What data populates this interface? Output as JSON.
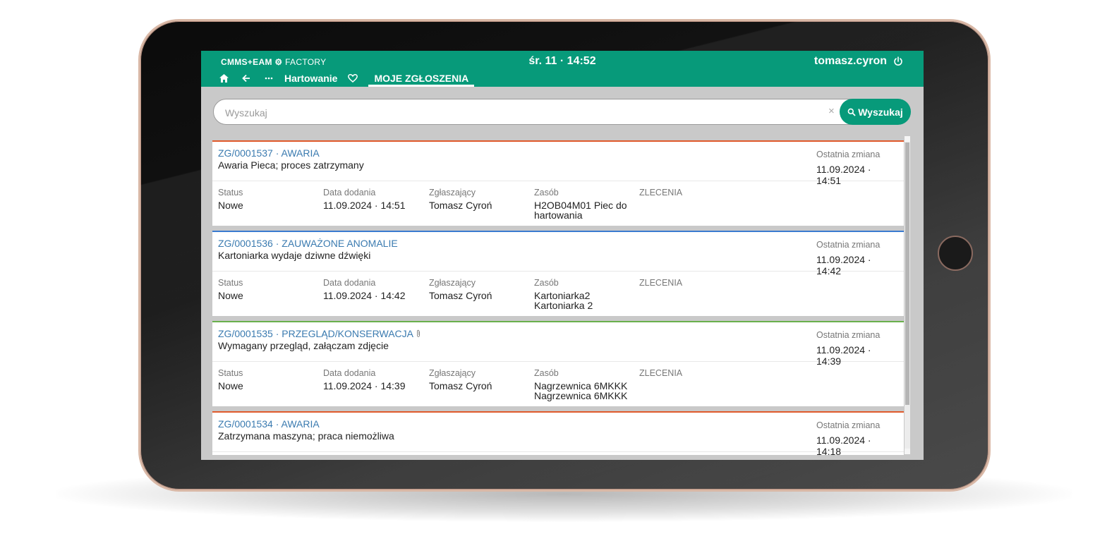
{
  "header": {
    "logo_bold": "CMMS+EAM",
    "logo_light": "FACTORY",
    "clock": "śr. 11 · 14:52",
    "user": "tomasz.cyron"
  },
  "nav": {
    "breadcrumb": "Hartowanie",
    "active_tab": "MOJE ZGŁOSZENIA"
  },
  "search": {
    "placeholder": "Wyszukaj",
    "clear": "×",
    "button": "Wyszukaj"
  },
  "labels": {
    "last_change": "Ostatnia zmiana",
    "status": "Status",
    "date_added": "Data dodania",
    "reporter": "Zgłaszający",
    "asset": "Zasób",
    "orders": "ZLECENIA"
  },
  "colors": {
    "accent": "#079a7a",
    "awaria": "#e05a2b",
    "anomalie": "#3b7bd0",
    "przeglad": "#6ab04c"
  },
  "tickets": [
    {
      "id": "ZG/0001537 · AWARIA",
      "description": "Awaria Pieca; proces zatrzymany",
      "last_change": "11.09.2024 · 14:51",
      "status": "Nowe",
      "date_added": "11.09.2024 · 14:51",
      "reporter": "Tomasz Cyroń",
      "asset_line1": "H2OB04M01 Piec do",
      "asset_line2": "hartowania"
    },
    {
      "id": "ZG/0001536 · ZAUWAŻONE ANOMALIE",
      "description": "Kartoniarka wydaje dziwne dźwięki",
      "last_change": "11.09.2024 · 14:42",
      "status": "Nowe",
      "date_added": "11.09.2024 · 14:42",
      "reporter": "Tomasz Cyroń",
      "asset_line1": "Kartoniarka2",
      "asset_line2": "Kartoniarka 2"
    },
    {
      "id": "ZG/0001535 · PRZEGLĄD/KONSERWACJA",
      "description": "Wymagany przegląd, załączam zdjęcie",
      "last_change": "11.09.2024 · 14:39",
      "status": "Nowe",
      "date_added": "11.09.2024 · 14:39",
      "reporter": "Tomasz Cyroń",
      "asset_line1": "Nagrzewnica 6MKKK",
      "asset_line2": "Nagrzewnica 6MKKK"
    },
    {
      "id": "ZG/0001534 · AWARIA",
      "description": "Zatrzymana maszyna; praca niemożliwa",
      "last_change": "11.09.2024 · 14:18"
    }
  ]
}
